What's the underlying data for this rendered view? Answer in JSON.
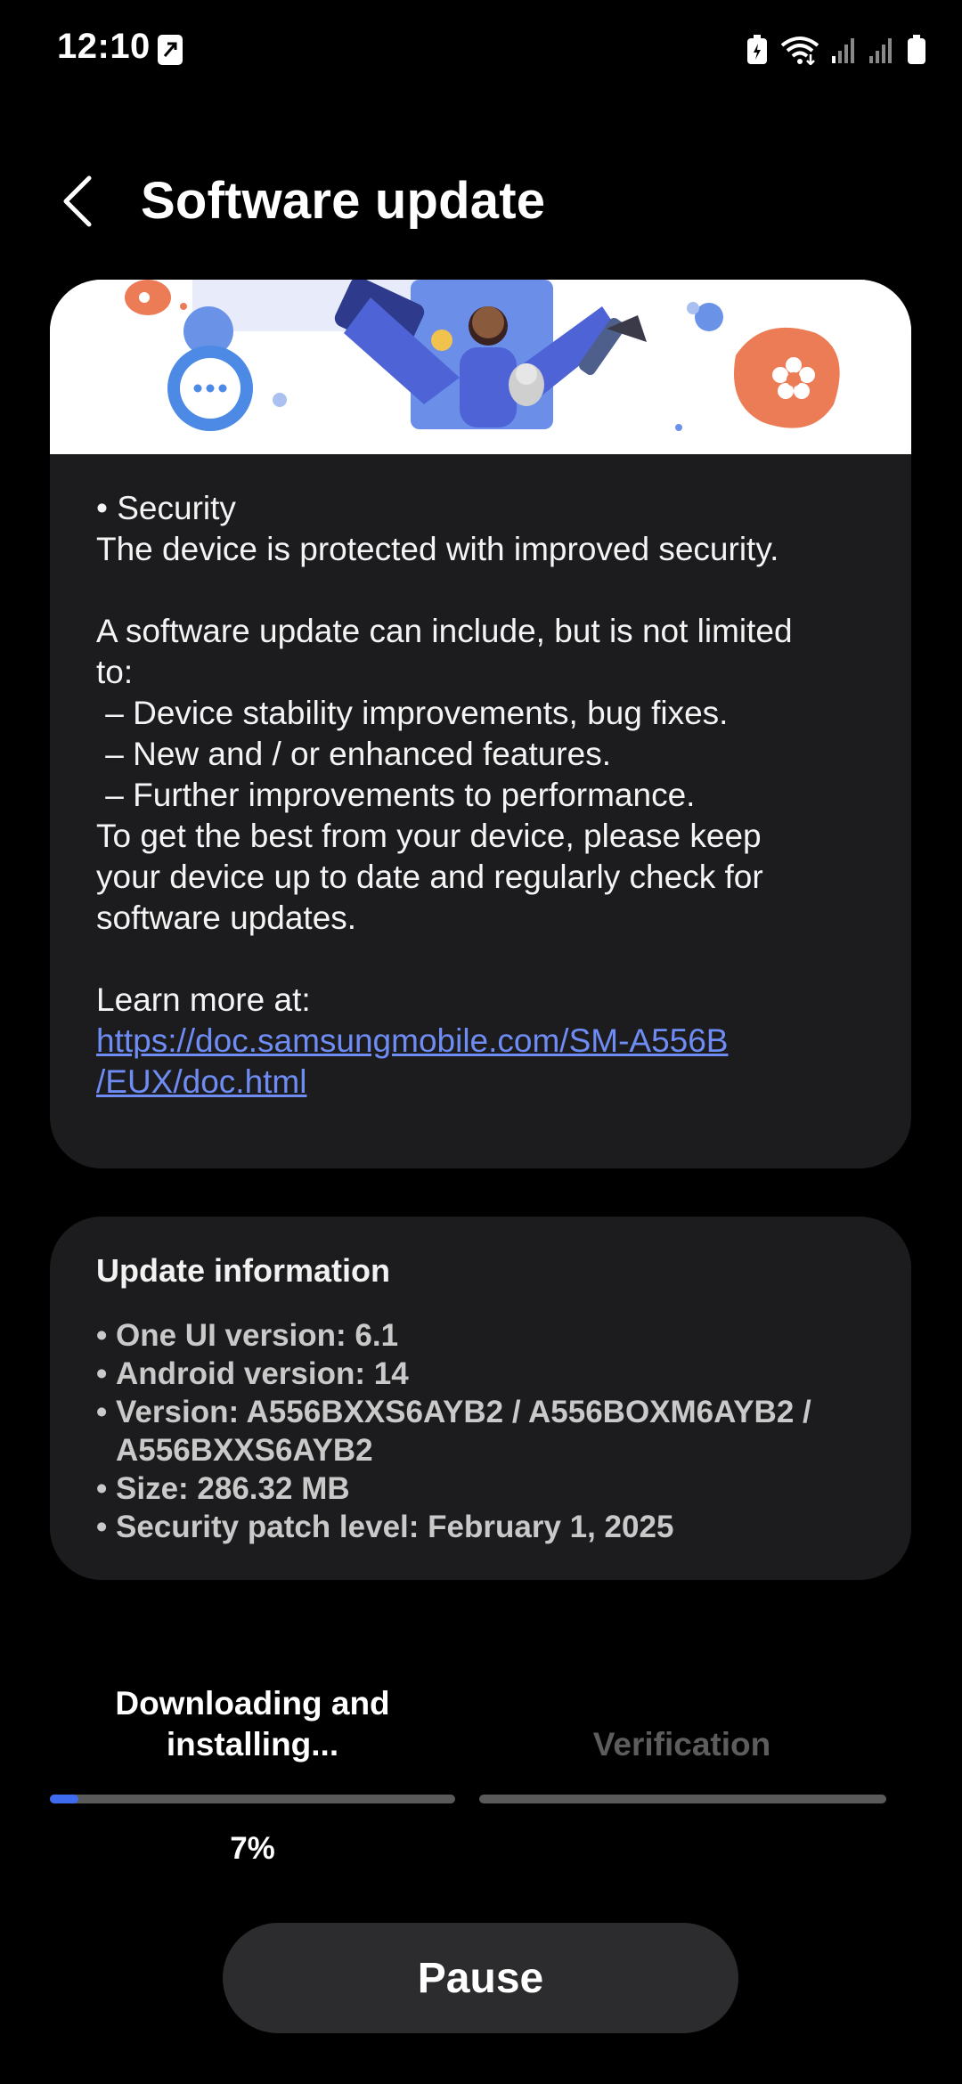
{
  "status_bar": {
    "time": "12:10",
    "icons": [
      "nfc-icon",
      "battery-saver-icon",
      "wifi-icon",
      "signal-icon",
      "signal-icon",
      "battery-icon"
    ]
  },
  "header": {
    "title": "Software update",
    "back_icon": "chevron-left-icon"
  },
  "release_notes": {
    "lines": [
      "• Security",
      "The device is protected with improved security.",
      "",
      "A software update can include, but is not limited",
      "to:",
      " – Device stability improvements, bug fixes.",
      " – New and / or enhanced features.",
      " – Further improvements to performance.",
      "To get the best from your device, please keep",
      "your device up to date and regularly check for",
      "software updates.",
      "",
      "Learn more at:"
    ],
    "link_line1": "https://doc.samsungmobile.com/SM-A556B",
    "link_line2": "/EUX/doc.html"
  },
  "update_info": {
    "title": "Update information",
    "items": [
      "One UI version: 6.1",
      "Android version: 14",
      "Version: A556BXXS6AYB2 / A556BOXM6AYB2 / A556BXXS6AYB2",
      "Size: 286.32 MB",
      "Security patch level: February 1, 2025"
    ]
  },
  "progress": {
    "step1_label_line1": "Downloading and",
    "step1_label_line2": "installing...",
    "step2_label": "Verification",
    "percent_text": "7%",
    "fraction": 0.07
  },
  "actions": {
    "pause_label": "Pause"
  },
  "colors": {
    "background": "#000000",
    "card": "#1c1c1e",
    "accent": "#3e6bf0",
    "link": "#6e8cf3",
    "button": "#2c2c2e"
  }
}
